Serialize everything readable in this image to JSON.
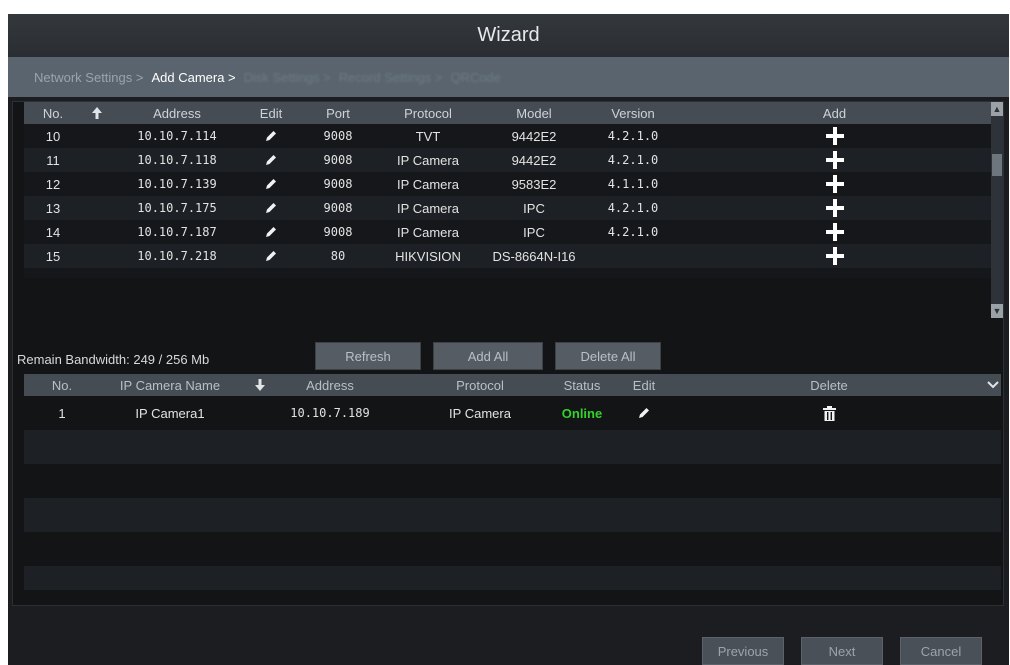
{
  "window": {
    "title": "Wizard"
  },
  "steps": [
    {
      "label": "Network Settings >",
      "state": "done"
    },
    {
      "label": "Add Camera >",
      "state": "active"
    },
    {
      "label": "Disk Settings >",
      "state": "future"
    },
    {
      "label": "Record Settings >",
      "state": "future"
    },
    {
      "label": "QRCode",
      "state": "future"
    }
  ],
  "search_table": {
    "headers": {
      "no": "No.",
      "sort_icon": "up-arrow-icon",
      "address": "Address",
      "edit": "Edit",
      "port": "Port",
      "protocol": "Protocol",
      "model": "Model",
      "version": "Version",
      "add": "Add"
    },
    "rows": [
      {
        "no": "10",
        "address": "10.10.7.114",
        "port": "9008",
        "protocol": "TVT",
        "model": "9442E2",
        "version": "4.2.1.0"
      },
      {
        "no": "11",
        "address": "10.10.7.118",
        "port": "9008",
        "protocol": "IP Camera",
        "model": "9442E2",
        "version": "4.2.1.0"
      },
      {
        "no": "12",
        "address": "10.10.7.139",
        "port": "9008",
        "protocol": "IP Camera",
        "model": "9583E2",
        "version": "4.1.1.0"
      },
      {
        "no": "13",
        "address": "10.10.7.175",
        "port": "9008",
        "protocol": "IP Camera",
        "model": "IPC",
        "version": "4.2.1.0"
      },
      {
        "no": "14",
        "address": "10.10.7.187",
        "port": "9008",
        "protocol": "IP Camera",
        "model": "IPC",
        "version": "4.2.1.0"
      },
      {
        "no": "15",
        "address": "10.10.7.218",
        "port": "80",
        "protocol": "HIKVISION",
        "model": "DS-8664N-I16",
        "version": ""
      }
    ]
  },
  "bandwidth": {
    "text": "Remain Bandwidth: 249 / 256 Mb"
  },
  "actions": {
    "refresh": "Refresh",
    "add_all": "Add All",
    "delete_all": "Delete All"
  },
  "added_table": {
    "headers": {
      "no": "No.",
      "name": "IP Camera Name",
      "sort_icon": "down-arrow-icon",
      "address": "Address",
      "protocol": "Protocol",
      "status": "Status",
      "edit": "Edit",
      "delete": "Delete"
    },
    "rows": [
      {
        "no": "1",
        "name": "IP Camera1",
        "address": "10.10.7.189",
        "protocol": "IP Camera",
        "status": "Online"
      }
    ]
  },
  "footer": {
    "previous": "Previous",
    "next": "Next",
    "cancel": "Cancel"
  },
  "colors": {
    "online": "#35d12a",
    "header_bg": "#454c54",
    "steps_bg": "#59646e"
  }
}
